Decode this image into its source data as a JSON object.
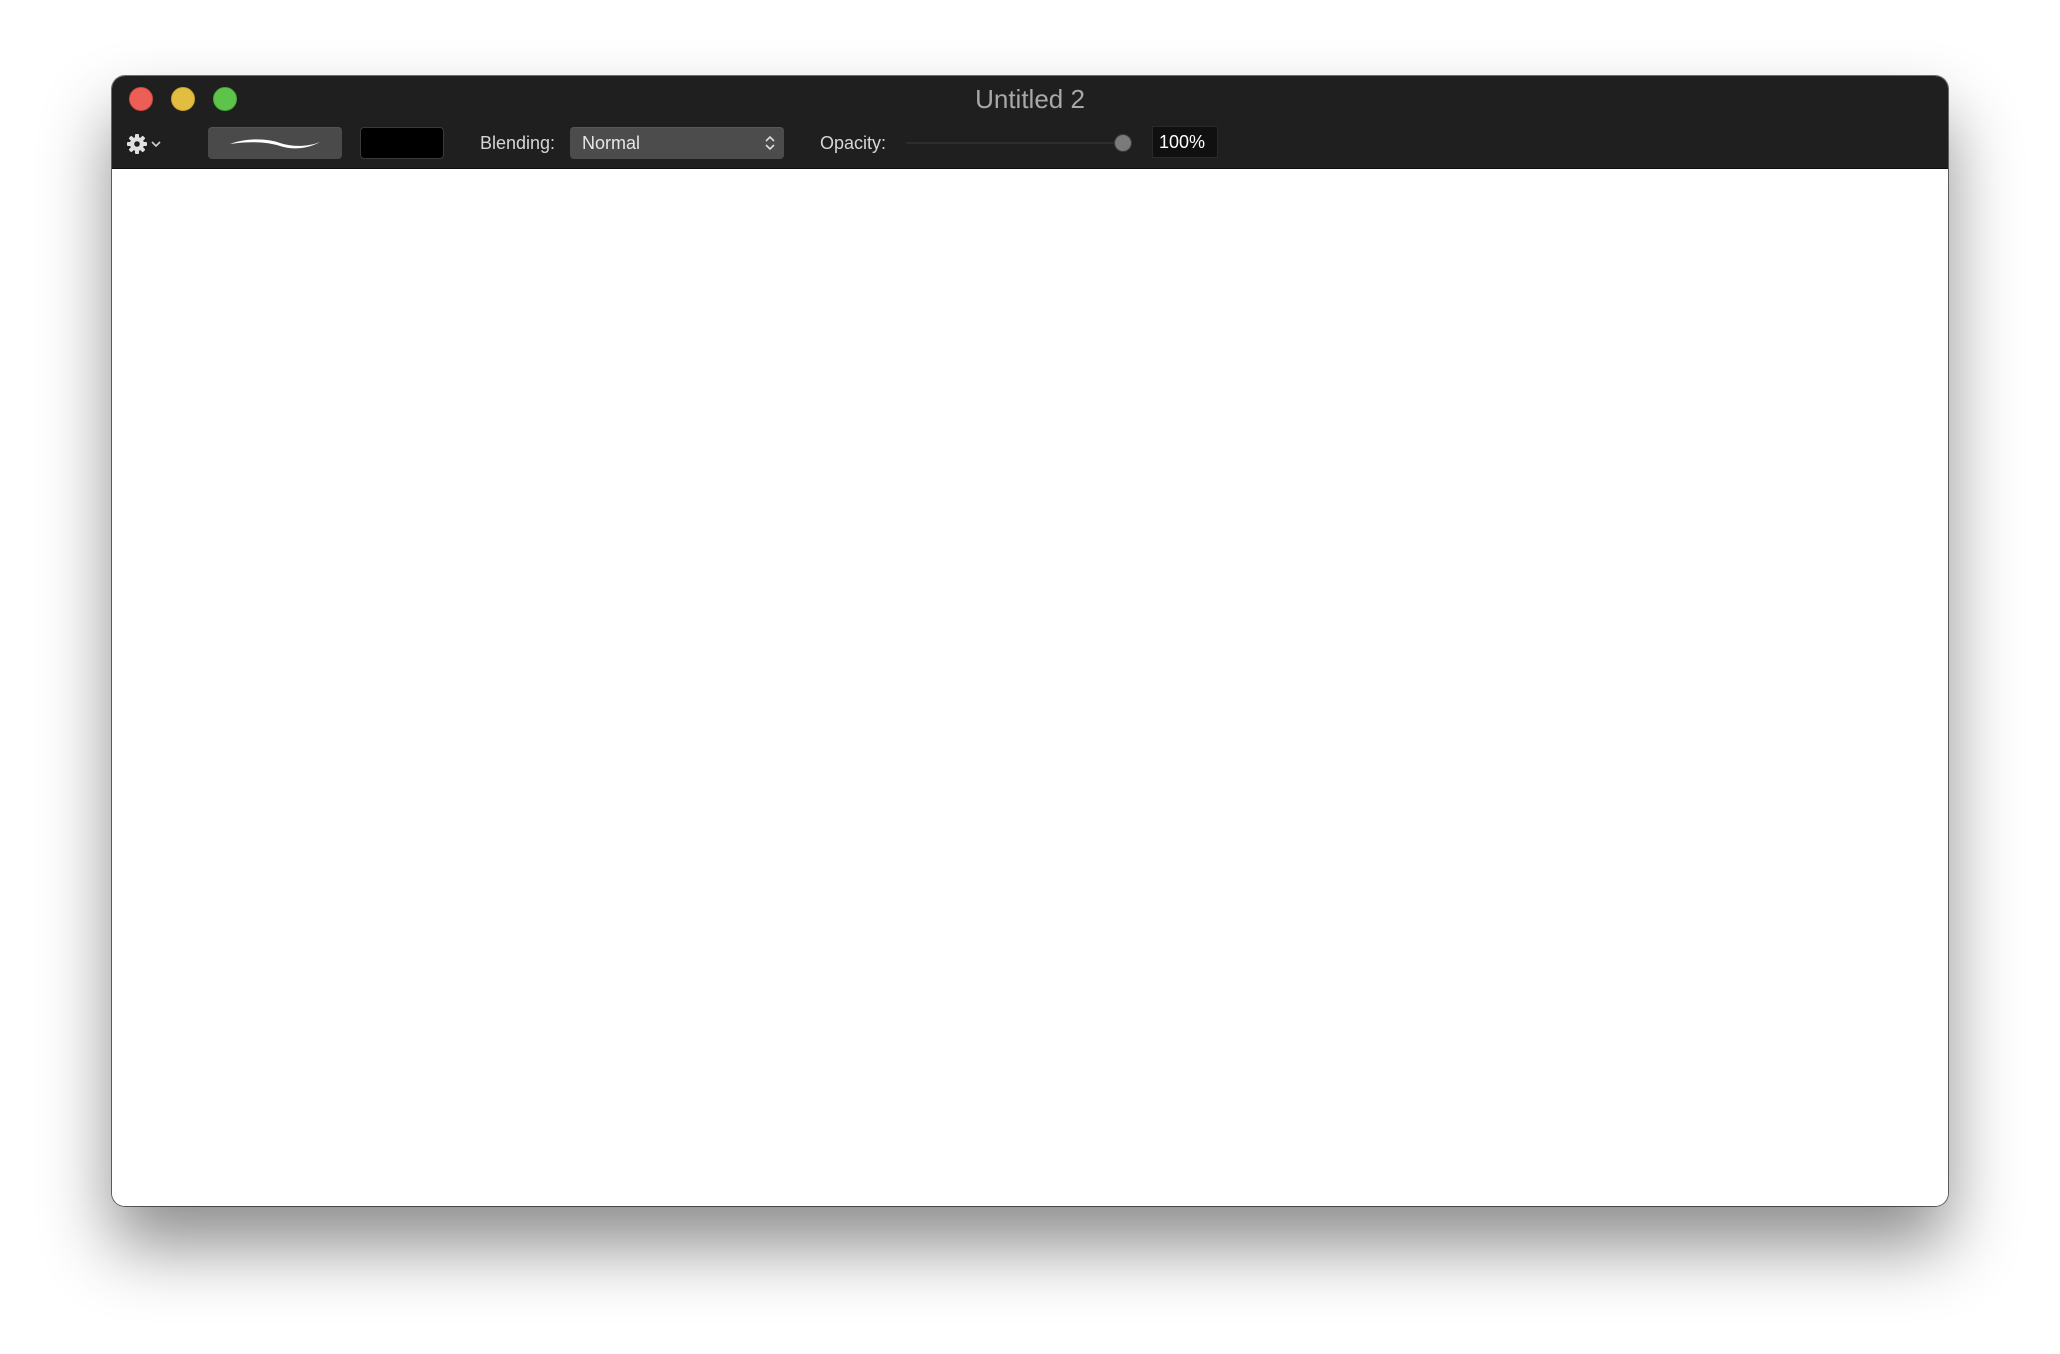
{
  "window": {
    "title": "Untitled 2"
  },
  "toolbar": {
    "gear_icon": "gear-icon",
    "menu_chevron_icon": "chevron-down-icon",
    "brush_preview_icon": "brush-stroke-icon",
    "current_color": "#000000",
    "blending_label": "Blending:",
    "blending_value": "Normal",
    "opacity_label": "Opacity:",
    "opacity_value": "100%",
    "opacity_fraction": 1.0
  },
  "colors": {
    "titlebar_bg": "#1f1f1f",
    "close_button": "#ed5f56",
    "minimize_button": "#e3bd3f",
    "zoom_button": "#5ec34b",
    "canvas_bg": "#ffffff"
  }
}
